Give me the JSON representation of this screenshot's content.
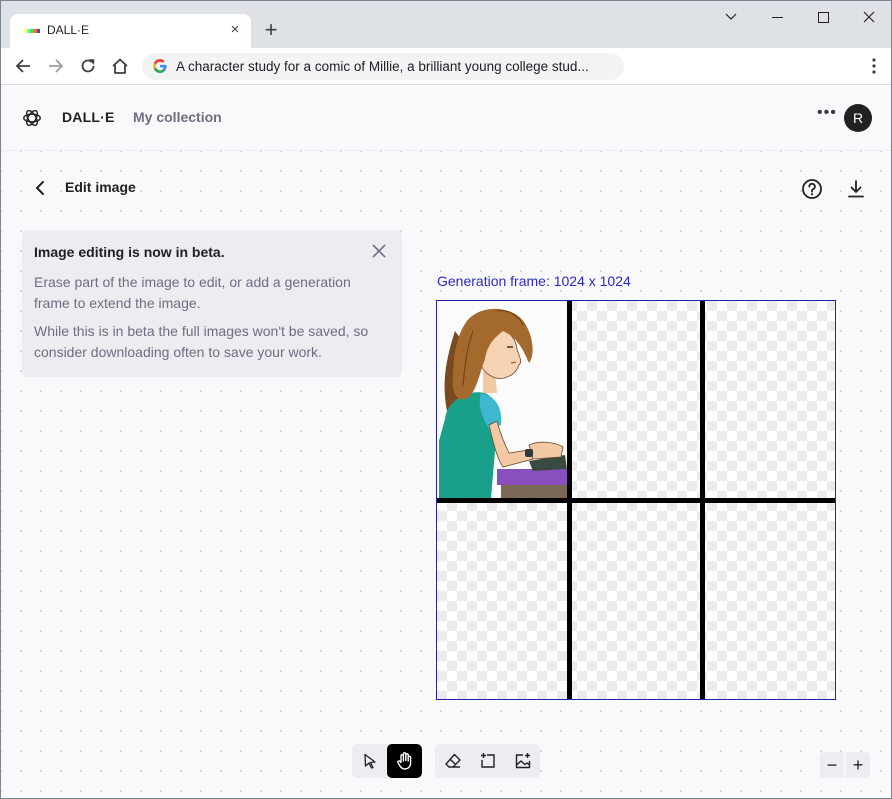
{
  "browser": {
    "tab_title": "DALL·E",
    "tab_close": "×",
    "new_tab": "+",
    "address": "A character study for a comic of Millie, a brilliant young college stud..."
  },
  "app": {
    "brand": "DALL·E",
    "collection_link": "My collection",
    "avatar_initial": "R"
  },
  "editor": {
    "title": "Edit image",
    "frame_label": "Generation frame: 1024 x 1024"
  },
  "beta_notice": {
    "title": "Image editing is now in beta.",
    "line1": "Erase part of the image to edit, or add a generation frame to extend the image.",
    "line2": "While this is in beta the full images won't be saved, so consider downloading often to save your work."
  },
  "tools": {
    "items": [
      "select-tool",
      "hand-tool",
      "eraser-tool",
      "add-generation-frame-tool",
      "upload-image-tool"
    ],
    "active": "hand-tool"
  },
  "zoom": {
    "out": "−",
    "in": "+"
  },
  "colors": {
    "frame_accent": "#2929d0",
    "avatar_bg": "#202123",
    "active_tool_bg": "#000000"
  }
}
